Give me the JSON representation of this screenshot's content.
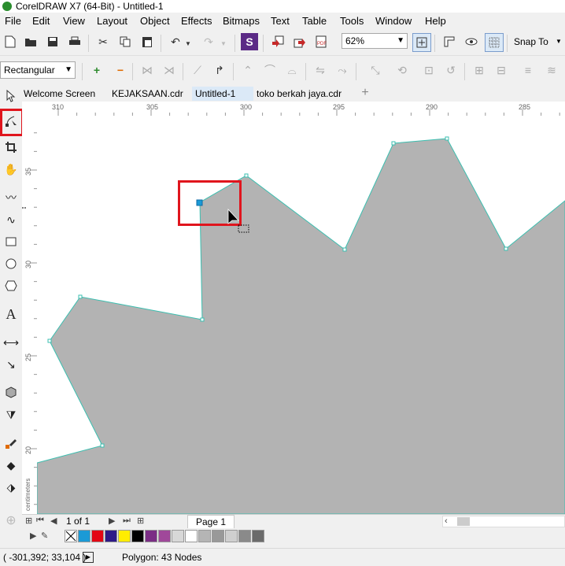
{
  "window": {
    "title": "CorelDRAW X7 (64-Bit) - Untitled-1"
  },
  "menu": [
    "File",
    "Edit",
    "View",
    "Layout",
    "Object",
    "Effects",
    "Bitmaps",
    "Text",
    "Table",
    "Tools",
    "Window",
    "Help"
  ],
  "toolbar": {
    "zoom_value": "62%",
    "snap_label": "Snap To"
  },
  "property_bar": {
    "shape_mode": "Rectangular"
  },
  "tabs": [
    "Welcome Screen",
    "KEJAKSAAN.cdr",
    "Untitled-1",
    "toko berkah jaya.cdr"
  ],
  "active_tab": "Untitled-1",
  "ruler": {
    "h_labels": [
      "310",
      "305",
      "300",
      "295",
      "290",
      "285"
    ],
    "v_labels": [
      "35",
      "30",
      "25",
      "20"
    ],
    "v_unit": "centimeters"
  },
  "page_nav": {
    "page_count": "1 of 1",
    "page_tab": "Page 1"
  },
  "palette_colors": [
    "#ffffff",
    "#1b9ad6",
    "#e30613",
    "#2e1a87",
    "#ffed00",
    "#000000",
    "#7b2d85",
    "#a0489a",
    "#d8d8d8",
    "#ffffff",
    "#b5b5b5",
    "#999999",
    "#cfcfcf",
    "#8a8a8a",
    "#6b6b6b"
  ],
  "status": {
    "coordinates": "( -301,392; 33,104 )",
    "selection_info": "Polygon: 43 Nodes"
  },
  "shape": {
    "fill_color": "#b3b3b3",
    "outline_color": "#3bbfb0"
  }
}
